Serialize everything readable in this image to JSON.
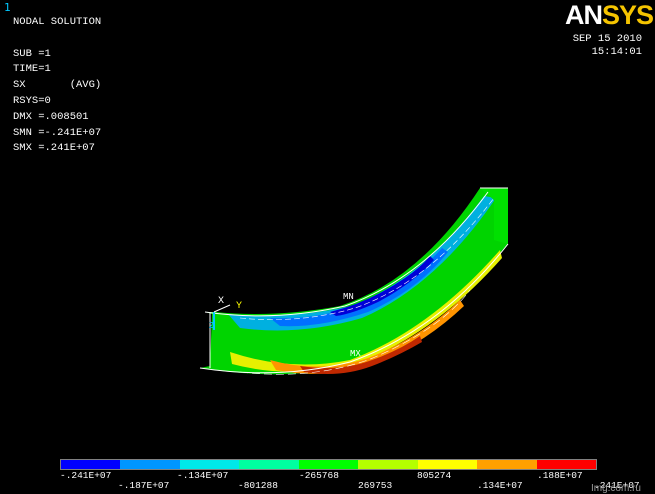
{
  "window_number": "1",
  "info_lines": [
    "NODAL SOLUTION",
    "",
    "SUB =1",
    "TIME=1",
    "SX       (AVG)",
    "RSYS=0",
    "DMX =.008501",
    "SMN =-.241E+07",
    "SMX =.241E+07"
  ],
  "logo": {
    "part1": "AN",
    "part2": "SYS"
  },
  "date": "SEP 15 2010",
  "time": "15:14:01",
  "markers": {
    "min": "MN",
    "max": "MX"
  },
  "triad": {
    "x": "X",
    "y": "Y",
    "z": "Z"
  },
  "legend": {
    "colors": [
      "#0000ff",
      "#0096ff",
      "#00e8e8",
      "#00ffa0",
      "#00ff00",
      "#b4ff00",
      "#ffff00",
      "#ffa000",
      "#ff0000"
    ],
    "labels_top": [
      "-.241E+07",
      "-.134E+07",
      "-265768",
      "805274",
      ".188E+07"
    ],
    "labels_bottom": [
      "-.187E+07",
      "-801288",
      "269753",
      ".134E+07",
      ".241E+07"
    ]
  },
  "watermark": "Img.com.ru"
}
